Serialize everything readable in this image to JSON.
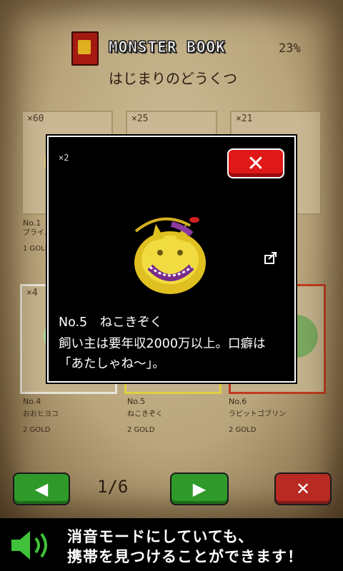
{
  "header": {
    "title": "MONSTER BOOK",
    "percent": "23%",
    "subtitle": "はじまりのどうくつ"
  },
  "cards": [
    {
      "count": "×60",
      "no": "No.1",
      "name": "プライム",
      "gold": "1 GOLD"
    },
    {
      "count": "×25",
      "no": "",
      "name": "",
      "gold": ""
    },
    {
      "count": "×21",
      "no": "",
      "name": "",
      "gold": ""
    },
    {
      "count": "×4",
      "no": "No.4",
      "name": "おおヒヨコ",
      "gold": "2 GOLD"
    },
    {
      "count": "",
      "no": "No.5",
      "name": "ねこきぞく",
      "gold": "2 GOLD"
    },
    {
      "count": "",
      "no": "No.6",
      "name": "ラビットゴブリン",
      "gold": "2 GOLD"
    }
  ],
  "pager": {
    "prev_label": "◀",
    "page": "1/6",
    "next_label": "▶",
    "close_label": "✕"
  },
  "modal": {
    "count": "×2",
    "close_label": "✕",
    "line1": "No.5　ねこきぞく",
    "line2": "飼い主は要年収2000万以上。口癖は",
    "line3": "「あたしゃね～」。"
  },
  "ad": {
    "line1": "消音モードにしていても、",
    "line2": "携帯を見つけることができます！"
  }
}
